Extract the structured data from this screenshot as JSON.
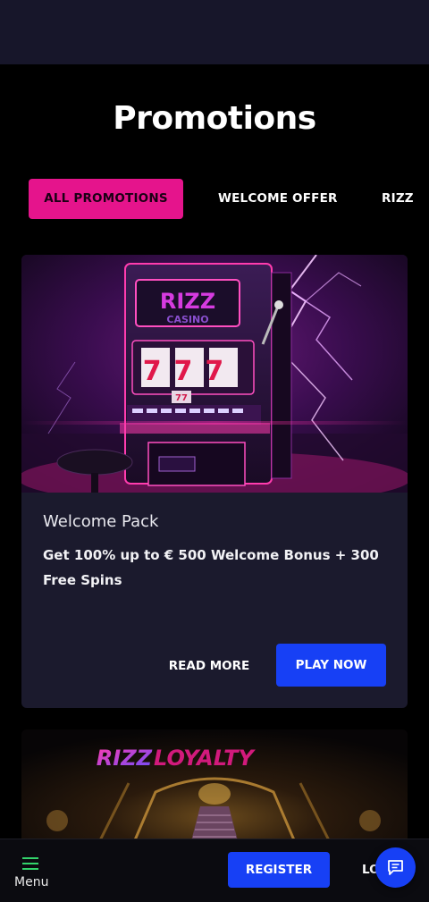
{
  "header": {
    "title": "Promotions"
  },
  "tabs": [
    {
      "label": "ALL PROMOTIONS",
      "active": true
    },
    {
      "label": "WELCOME OFFER",
      "active": false
    },
    {
      "label": "RIZZ",
      "active": false
    }
  ],
  "promotions": [
    {
      "image": {
        "brand_text": "RIZZ",
        "sub_text": "CASINO",
        "reels": "777",
        "reel_small": "77"
      },
      "name": "Welcome Pack",
      "description": "Get 100% up to € 500 Welcome Bonus + 300 Free Spins",
      "read_more_label": "READ MORE",
      "play_label": "PLAY NOW"
    },
    {
      "image": {
        "brand_text": "RIZZ",
        "brand_text_2": "LOYALTY"
      }
    }
  ],
  "bottom_nav": {
    "menu_label": "Menu",
    "register_label": "REGISTER",
    "login_label": "LO"
  },
  "icons": {
    "menu": "hamburger-icon",
    "chat": "chat-bubble-icon"
  },
  "colors": {
    "accent_pink": "#e5148c",
    "accent_blue": "#1740f5",
    "card_bg": "#1b1a2d",
    "menu_icon": "#33d36b"
  }
}
